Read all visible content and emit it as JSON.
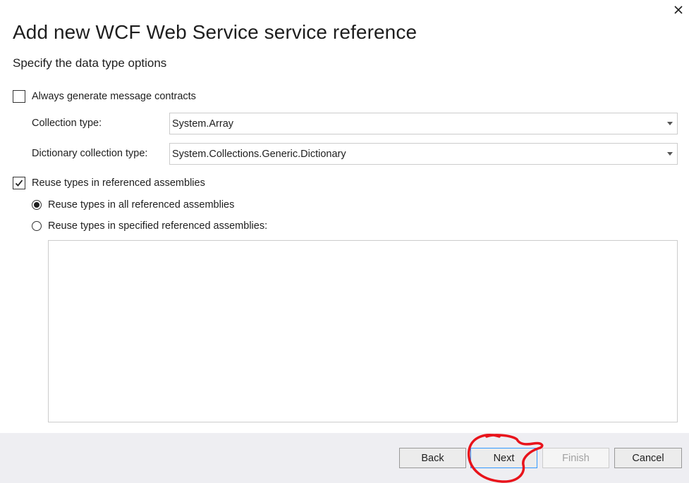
{
  "dialog": {
    "title": "Add new WCF Web Service service reference",
    "subtitle": "Specify the data type options",
    "close_icon": "close-icon"
  },
  "options": {
    "message_contracts": {
      "label": "Always generate message contracts",
      "checked": false
    },
    "collection_type": {
      "label": "Collection type:",
      "value": "System.Array"
    },
    "dictionary_collection_type": {
      "label": "Dictionary collection type:",
      "value": "System.Collections.Generic.Dictionary"
    },
    "reuse_types": {
      "label": "Reuse types in referenced assemblies",
      "checked": true,
      "radio_all": {
        "label": "Reuse types in all referenced assemblies",
        "selected": true
      },
      "radio_specified": {
        "label": "Reuse types in specified referenced assemblies:",
        "selected": false
      }
    }
  },
  "footer": {
    "back_label": "Back",
    "next_label": "Next",
    "finish_label": "Finish",
    "cancel_label": "Cancel"
  },
  "colors": {
    "footer_bg": "#eeeef2",
    "annotation": "#e8131b",
    "primary_border": "#3399ff"
  }
}
